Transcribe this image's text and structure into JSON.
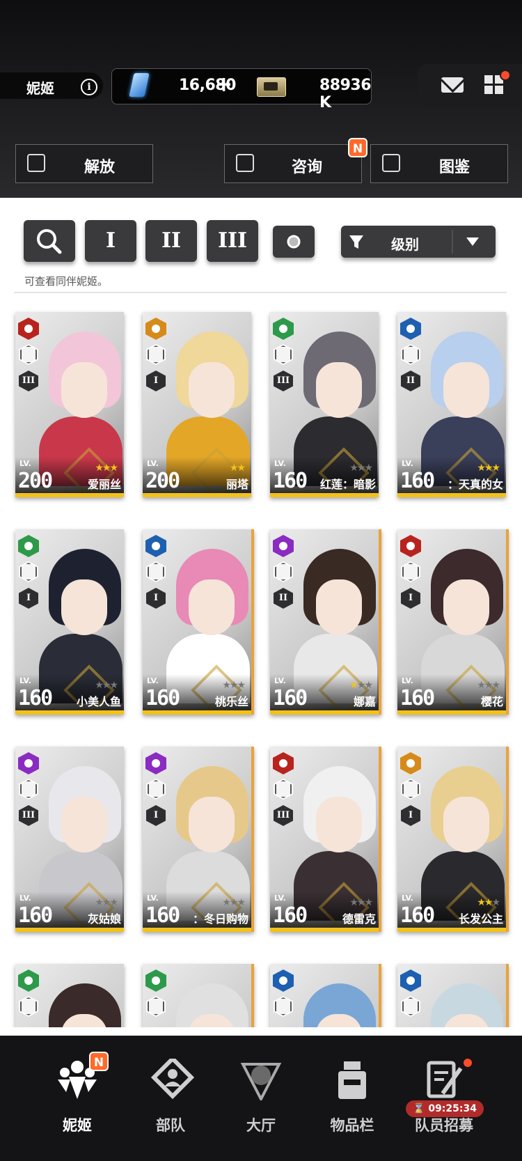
{
  "header": {
    "page_label": "妮姬",
    "info_icon_glyph": "i",
    "currency": {
      "gems": "16,680",
      "plus": "+",
      "credits": "88936 K"
    }
  },
  "top_buttons": {
    "release": "解放",
    "consult": "咨询",
    "codex": "图鉴",
    "new_badge": "N"
  },
  "filters": {
    "search_icon": "search-icon",
    "class_1": "I",
    "class_2": "II",
    "class_3": "III",
    "sort_label": "级别",
    "hint": "可查看同伴妮姬。"
  },
  "cards": [
    {
      "name": "爱丽丝",
      "lv_label": "LV.",
      "level": "200",
      "element": "fire",
      "burst": "III",
      "stars_gold": 3,
      "stars_grey": 0,
      "hair": "#f2c6d8",
      "color": "#c8384a"
    },
    {
      "name": "丽塔",
      "lv_label": "LV.",
      "level": "200",
      "element": "iron",
      "burst": "I",
      "stars_gold": 2,
      "stars_grey": 0,
      "hair": "#f0d79a",
      "color": "#e3a627"
    },
    {
      "name": "红莲：暗影",
      "lv_label": "LV.",
      "level": "160",
      "element": "wind",
      "burst": "III",
      "stars_gold": 0,
      "stars_grey": 3,
      "hair": "#6d6a74",
      "color": "#2b2b30"
    },
    {
      "name": "：天真的女",
      "lv_label": "LV.",
      "level": "160",
      "element": "water",
      "burst": "II",
      "stars_gold": 3,
      "stars_grey": 0,
      "hair": "#b8cfee",
      "color": "#3a3f5a"
    },
    {
      "name": "小美人鱼",
      "lv_label": "LV.",
      "level": "160",
      "element": "wind",
      "burst": "I",
      "stars_gold": 0,
      "stars_grey": 3,
      "hair": "#1e2230",
      "color": "#2a2d38"
    },
    {
      "name": "桃乐丝",
      "lv_label": "LV.",
      "level": "160",
      "element": "water",
      "burst": "I",
      "stars_gold": 0,
      "stars_grey": 3,
      "hair": "#e989b6",
      "color": "#ffffff"
    },
    {
      "name": "娜嘉",
      "lv_label": "LV.",
      "level": "160",
      "element": "electric",
      "burst": "II",
      "stars_gold": 1,
      "stars_grey": 2,
      "hair": "#3a2a24",
      "color": "#e8e8e8"
    },
    {
      "name": "樱花",
      "lv_label": "LV.",
      "level": "160",
      "element": "fire",
      "burst": "I",
      "stars_gold": 0,
      "stars_grey": 3,
      "hair": "#3c2a2c",
      "color": "#d8d8d8"
    },
    {
      "name": "灰姑娘",
      "lv_label": "LV.",
      "level": "160",
      "element": "electric",
      "burst": "III",
      "stars_gold": 0,
      "stars_grey": 3,
      "hair": "#e8e8ec",
      "color": "#c8c8cc"
    },
    {
      "name": "：冬日购物",
      "lv_label": "LV.",
      "level": "160",
      "element": "electric",
      "burst": "I",
      "stars_gold": 0,
      "stars_grey": 3,
      "hair": "#e6c98a",
      "color": "#dcdcdc"
    },
    {
      "name": "德雷克",
      "lv_label": "LV.",
      "level": "160",
      "element": "fire",
      "burst": "III",
      "stars_gold": 0,
      "stars_grey": 3,
      "hair": "#f0f0f0",
      "color": "#3a3034"
    },
    {
      "name": "长发公主",
      "lv_label": "LV.",
      "level": "160",
      "element": "iron",
      "burst": "I",
      "stars_gold": 2,
      "stars_grey": 1,
      "hair": "#e8cf8f",
      "color": "#2a2a2e"
    },
    {
      "element": "wind",
      "hair": "#3a2a2a",
      "color": "#cccccc"
    },
    {
      "element": "wind",
      "hair": "#e0e0e0",
      "color": "#cccccc"
    },
    {
      "element": "water",
      "hair": "#7aa6d6",
      "color": "#cccccc"
    },
    {
      "element": "water",
      "hair": "#c8d8e0",
      "color": "#cccccc"
    }
  ],
  "element_colors": {
    "fire": "#b8231e",
    "iron": "#d68a1a",
    "wind": "#2d9a4a",
    "water": "#1d5fb0",
    "electric": "#8a2bc2"
  },
  "nav": {
    "items": [
      "妮姬",
      "部队",
      "大厅",
      "物品栏",
      "队员招募"
    ],
    "timer": "09:25:34",
    "new_badge": "N"
  }
}
